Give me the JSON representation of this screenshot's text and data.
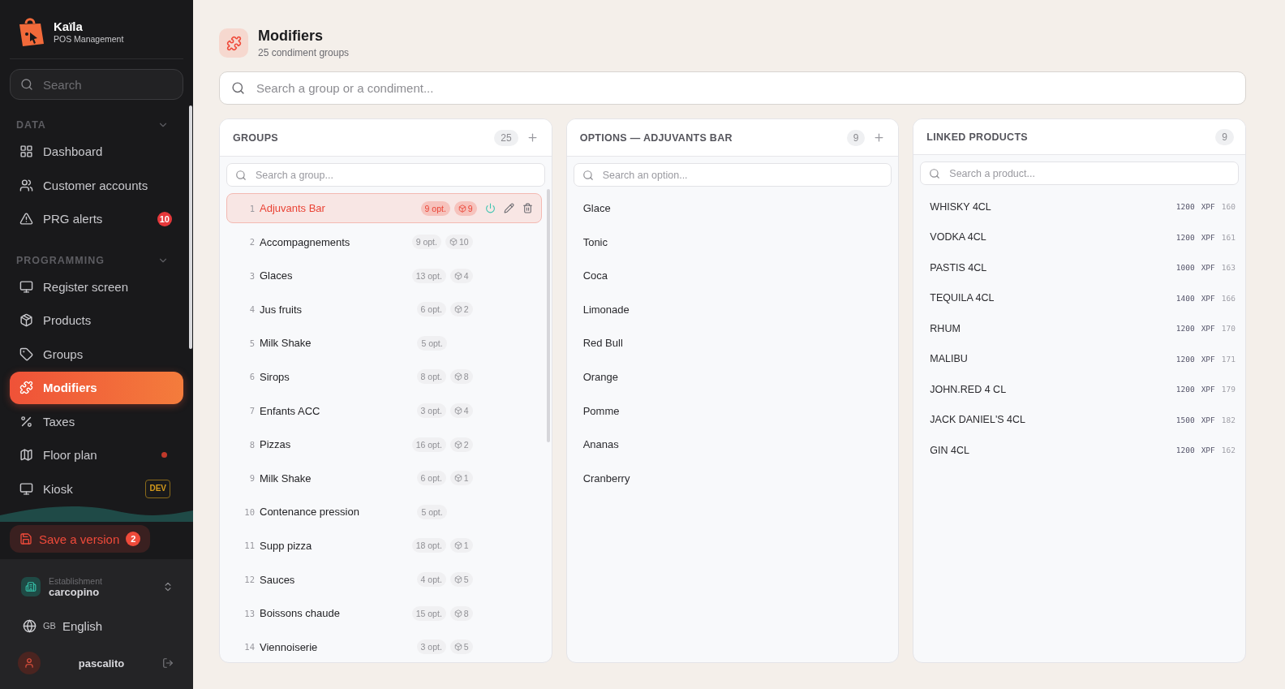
{
  "brand": {
    "name": "Kaïla",
    "subtitle": "POS Management"
  },
  "sidebar_search": {
    "placeholder": "Search"
  },
  "sidebar_sections": [
    {
      "title": "DATA",
      "expanded": true,
      "items": [
        {
          "label": "Dashboard",
          "selected": false
        },
        {
          "label": "Customer accounts",
          "selected": false
        },
        {
          "label": "PRG alerts",
          "selected": false,
          "badge": "10"
        }
      ]
    },
    {
      "title": "PROGRAMMING",
      "expanded": true,
      "items": [
        {
          "label": "Register screen",
          "selected": false
        },
        {
          "label": "Products",
          "selected": false
        },
        {
          "label": "Groups",
          "selected": false
        },
        {
          "label": "Modifiers",
          "selected": true
        },
        {
          "label": "Taxes",
          "selected": false
        },
        {
          "label": "Floor plan",
          "selected": false,
          "dot": true
        },
        {
          "label": "Kiosk",
          "selected": false,
          "tag": "DEV"
        }
      ]
    }
  ],
  "save_button": {
    "label": "Save a version",
    "badge": "2"
  },
  "establishment": {
    "label": "Establishment",
    "value": "carcopino"
  },
  "language": {
    "code": "GB",
    "label": "English"
  },
  "user": {
    "name": "pascalito"
  },
  "page": {
    "title": "Modifiers",
    "subtitle": "25 condiment groups"
  },
  "global_search": {
    "placeholder": "Search a group or a condiment..."
  },
  "groups_panel": {
    "title": "GROUPS",
    "count": "25",
    "search_placeholder": "Search a group...",
    "groups": [
      {
        "number": "1",
        "name": "Adjuvants Bar",
        "options": "9 opt.",
        "products": "9",
        "selected": true
      },
      {
        "number": "2",
        "name": "Accompagnements",
        "options": "9 opt.",
        "products": "10",
        "selected": false
      },
      {
        "number": "3",
        "name": "Glaces",
        "options": "13 opt.",
        "products": "4",
        "selected": false
      },
      {
        "number": "4",
        "name": "Jus fruits",
        "options": "6 opt.",
        "products": "2",
        "selected": false
      },
      {
        "number": "5",
        "name": "Milk Shake",
        "options": "5 opt.",
        "selected": false
      },
      {
        "number": "6",
        "name": "Sirops",
        "options": "8 opt.",
        "products": "8",
        "selected": false
      },
      {
        "number": "7",
        "name": "Enfants ACC",
        "options": "3 opt.",
        "products": "4",
        "selected": false
      },
      {
        "number": "8",
        "name": "Pizzas",
        "options": "16 opt.",
        "products": "2",
        "selected": false
      },
      {
        "number": "9",
        "name": "Milk Shake",
        "options": "6 opt.",
        "products": "1",
        "selected": false
      },
      {
        "number": "10",
        "name": "Contenance pression",
        "options": "5 opt.",
        "selected": false
      },
      {
        "number": "11",
        "name": "Supp pizza",
        "options": "18 opt.",
        "products": "1",
        "selected": false
      },
      {
        "number": "12",
        "name": "Sauces",
        "options": "4 opt.",
        "products": "5",
        "selected": false
      },
      {
        "number": "13",
        "name": "Boissons chaude",
        "options": "15 opt.",
        "products": "8",
        "selected": false
      },
      {
        "number": "14",
        "name": "Viennoiserie",
        "options": "3 opt.",
        "products": "5",
        "selected": false
      }
    ]
  },
  "options_panel": {
    "title": "OPTIONS — ADJUVANTS BAR",
    "count": "9",
    "search_placeholder": "Search an option...",
    "options": [
      "Glace",
      "Tonic",
      "Coca",
      "Limonade",
      "Red Bull",
      "Orange",
      "Pomme",
      "Ananas",
      "Cranberry"
    ]
  },
  "products_panel": {
    "title": "LINKED PRODUCTS",
    "count": "9",
    "search_placeholder": "Search a product...",
    "products": [
      {
        "name": "WHISKY 4CL",
        "price": "1200",
        "currency": "XPF",
        "code": "160"
      },
      {
        "name": "VODKA 4CL",
        "price": "1200",
        "currency": "XPF",
        "code": "161"
      },
      {
        "name": "PASTIS 4CL",
        "price": "1000",
        "currency": "XPF",
        "code": "163"
      },
      {
        "name": "TEQUILA 4CL",
        "price": "1400",
        "currency": "XPF",
        "code": "166"
      },
      {
        "name": "RHUM",
        "price": "1200",
        "currency": "XPF",
        "code": "170"
      },
      {
        "name": "MALIBU",
        "price": "1200",
        "currency": "XPF",
        "code": "171"
      },
      {
        "name": "JOHN.RED 4 CL",
        "price": "1200",
        "currency": "XPF",
        "code": "179"
      },
      {
        "name": "JACK DANIEL'S 4CL",
        "price": "1500",
        "currency": "XPF",
        "code": "182"
      },
      {
        "name": "GIN 4CL",
        "price": "1200",
        "currency": "XPF",
        "code": "162"
      }
    ]
  }
}
